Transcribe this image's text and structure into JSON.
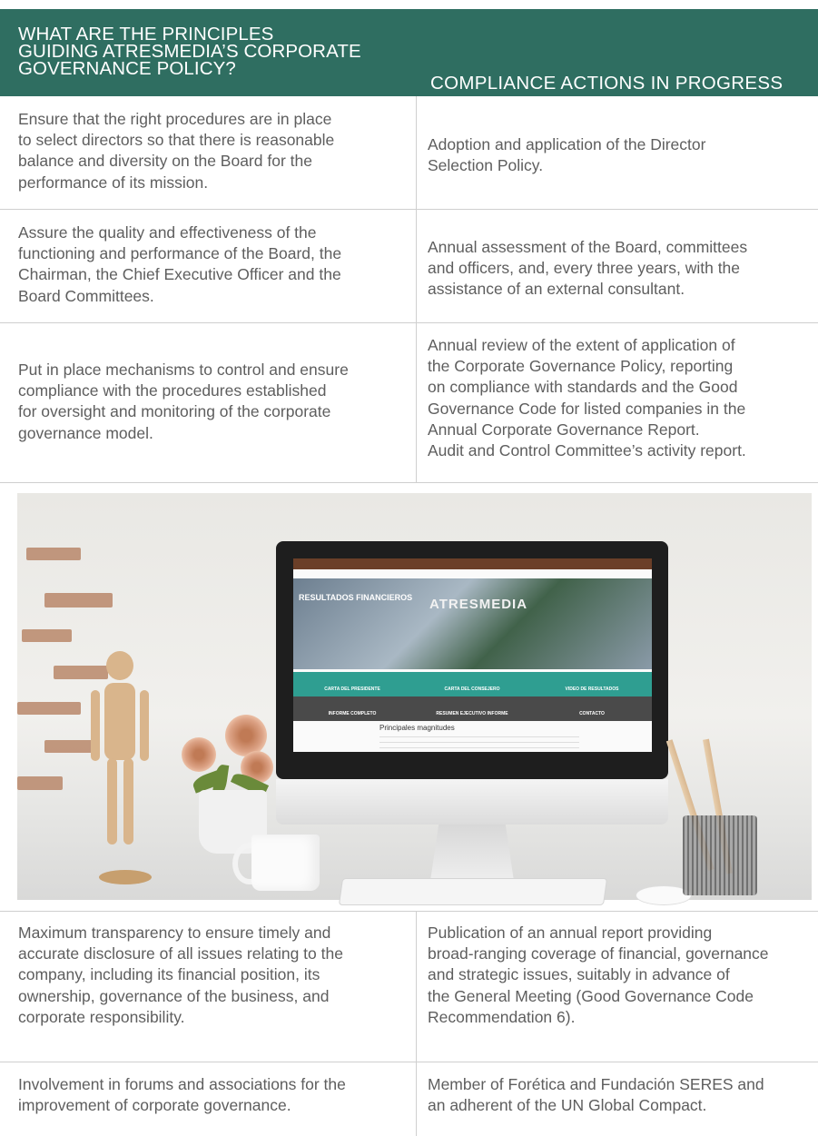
{
  "header": {
    "left_lines": [
      "WHAT ARE THE PRINCIPLES",
      "GUIDING ATRESMEDIA’S CORPORATE",
      "GOVERNANCE POLICY?"
    ],
    "right": "COMPLIANCE ACTIONS IN PROGRESS"
  },
  "rows": [
    {
      "principle": [
        "Ensure that the right procedures are in place",
        "to select directors so that there is reasonable",
        "balance and diversity on the Board for the",
        "performance of its mission."
      ],
      "action": [
        "Adoption and application of the Director",
        "Selection Policy."
      ]
    },
    {
      "principle": [
        "Assure the quality and effectiveness of the",
        "functioning and performance of the Board, the",
        "Chairman, the Chief Executive Officer and the",
        "Board Committees."
      ],
      "action": [
        "Annual assessment of the Board, committees",
        "and officers, and, every three years, with the",
        "assistance of an external consultant."
      ]
    },
    {
      "principle": [
        "Put in place mechanisms to control and ensure",
        "compliance with the procedures established",
        "for oversight and monitoring of the corporate",
        "governance model."
      ],
      "action": [
        "Annual review of the extent of application of",
        "the Corporate Governance Policy, reporting",
        "on compliance with standards and the Good",
        "Governance Code for listed companies in the",
        "Annual Corporate Governance Report.",
        "Audit and Control Committee’s activity report."
      ]
    },
    {
      "principle": [
        "Maximum transparency to ensure timely and",
        "accurate disclosure of all issues relating to the",
        "company, including its financial position, its",
        "ownership, governance of the business, and",
        "corporate responsibility."
      ],
      "action": [
        "Publication of an annual report providing",
        "broad-ranging coverage of financial, governance",
        "and strategic issues, suitably in advance of",
        "the General Meeting (Good Governance Code",
        "Recommendation 6)."
      ]
    },
    {
      "principle": [
        "Involvement in forums and associations for the",
        "improvement of corporate governance."
      ],
      "action": [
        "Member of Forética and Fundación SERES and",
        "an adherent of the UN Global Compact."
      ]
    }
  ],
  "photo_screen": {
    "hero_title": "RESULTADOS FINANCIEROS",
    "brand": "ATRESMEDIA",
    "tabs_top": [
      "CARTA DEL PRESIDENTE",
      "CARTA DEL CONSEJERO",
      "VIDEO DE RESULTADOS"
    ],
    "tabs_bottom": [
      "INFORME COMPLETO",
      "RESUMEN EJECUTIVO INFORME",
      "CONTACTO"
    ],
    "section_title": "Principales magnitudes"
  },
  "colors": {
    "header_bg": "#2f6e61",
    "text": "#5e5e5e",
    "rule": "#cfcfcf"
  }
}
